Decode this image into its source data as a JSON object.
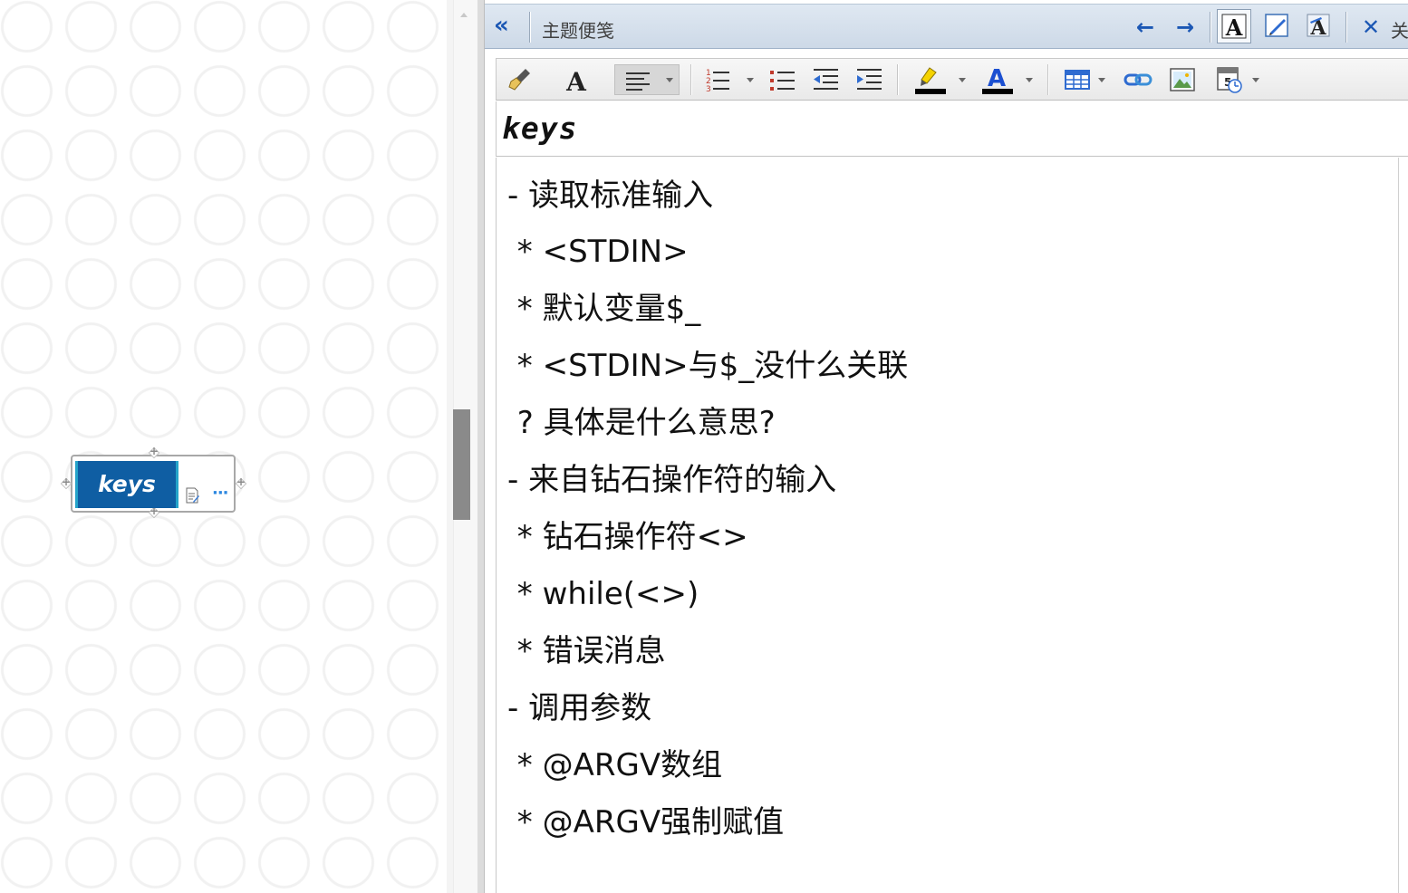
{
  "canvas": {
    "topic": {
      "label": "keys"
    }
  },
  "notes_pane": {
    "title": "主题便笺",
    "close_label": "关",
    "note_title": "keys",
    "lines": [
      "- 读取标准输入",
      " * <STDIN>",
      " * 默认变量$_",
      " * <STDIN>与$_没什么关联",
      " ? 具体是什么意思?",
      "- 来自钻石操作符的输入",
      " * 钻石操作符<>",
      " * while(<>)",
      " * 错误消息",
      "- 调用参数",
      " * @ARGV数组",
      " * @ARGV强制赋值"
    ]
  },
  "colors": {
    "topic_fill": "#0f5ea3",
    "topic_accent": "#24a3c9",
    "nav_blue": "#1b57b4",
    "highlight_yellow": "#f5d300",
    "font_color_blue": "#1b4fd1"
  },
  "icons": {
    "collapse": "double-chevron-left-icon",
    "back": "arrow-left-icon",
    "forward": "arrow-right-icon",
    "close": "close-icon"
  }
}
